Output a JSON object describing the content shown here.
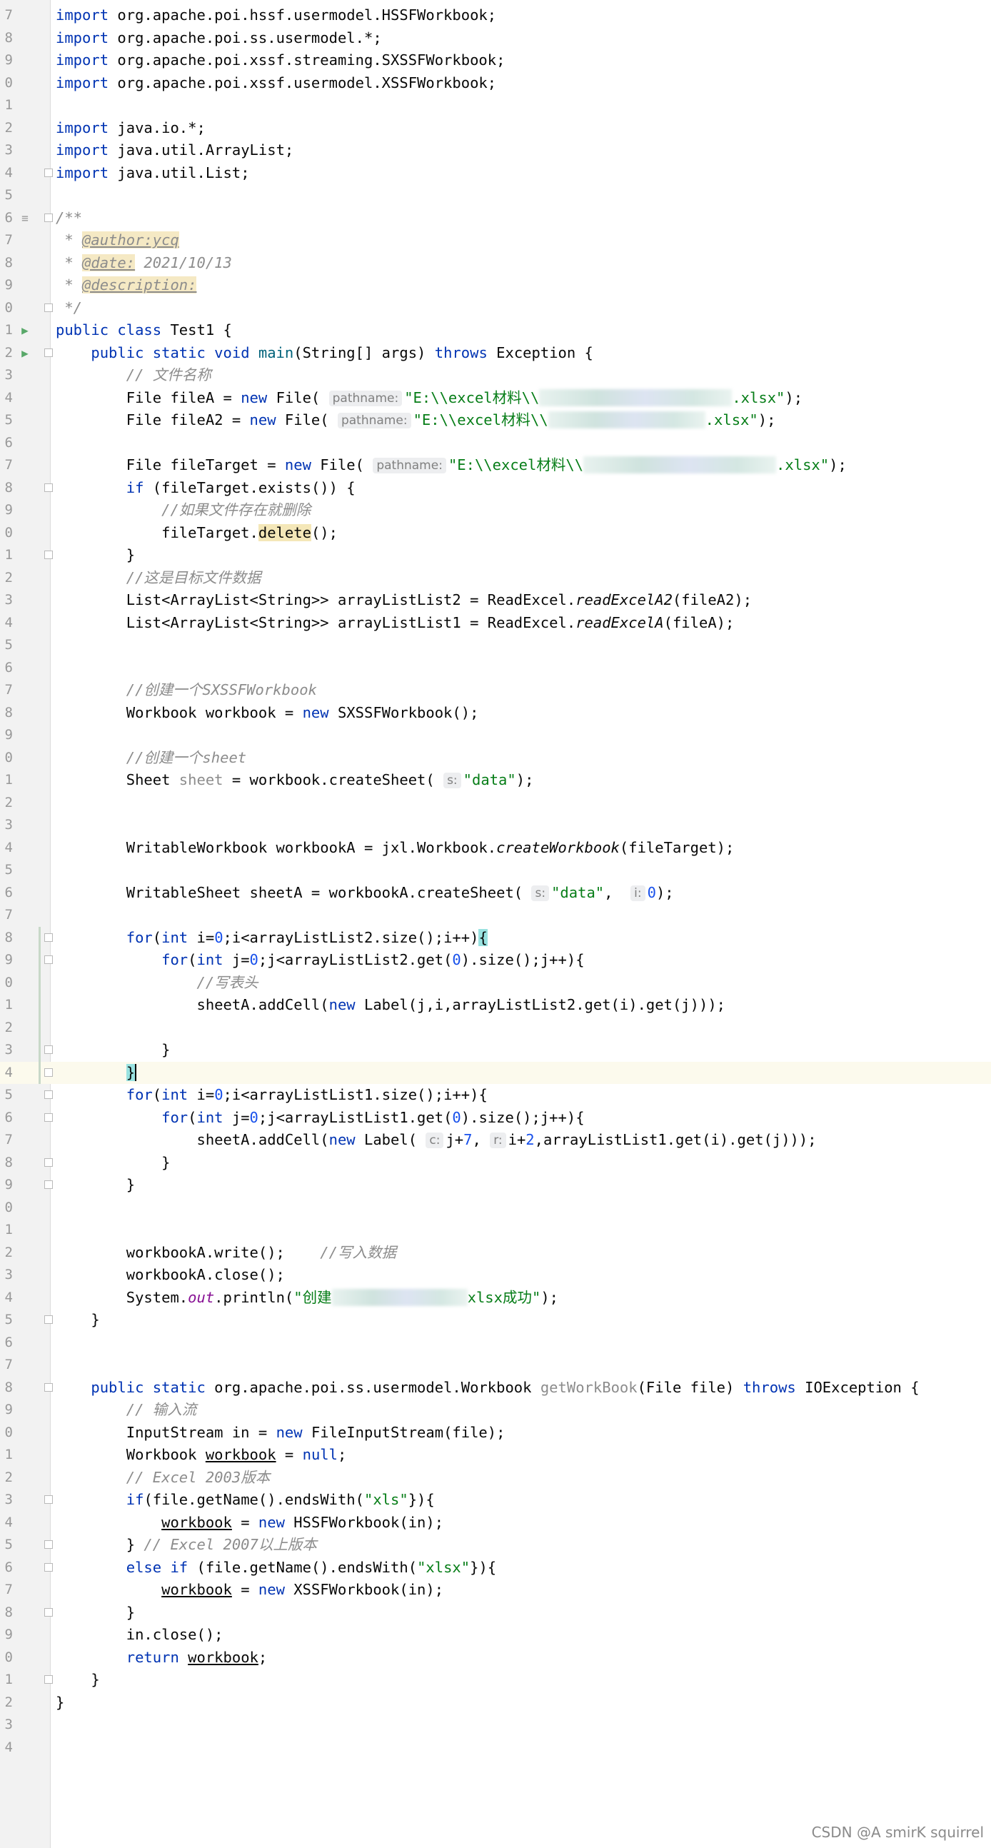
{
  "editor": {
    "watermark": "CSDN @A smirK squirrel",
    "lines": [
      {
        "n": "7",
        "segs": [
          [
            "kw",
            "import "
          ],
          [
            "",
            "org.apache.poi.hssf.usermodel.HSSFWorkbook;"
          ]
        ]
      },
      {
        "n": "8",
        "segs": [
          [
            "kw",
            "import "
          ],
          [
            "",
            "org.apache.poi.ss.usermodel.*;"
          ]
        ]
      },
      {
        "n": "9",
        "segs": [
          [
            "kw",
            "import "
          ],
          [
            "",
            "org.apache.poi.xssf.streaming.SXSSFWorkbook;"
          ]
        ]
      },
      {
        "n": "0",
        "segs": [
          [
            "kw",
            "import "
          ],
          [
            "",
            "org.apache.poi.xssf.usermodel.XSSFWorkbook;"
          ]
        ]
      },
      {
        "n": "1",
        "segs": []
      },
      {
        "n": "2",
        "segs": [
          [
            "kw",
            "import "
          ],
          [
            "",
            "java.io.*;"
          ]
        ]
      },
      {
        "n": "3",
        "segs": [
          [
            "kw",
            "import "
          ],
          [
            "",
            "java.util.ArrayList;"
          ]
        ]
      },
      {
        "n": "4",
        "fold": true,
        "segs": [
          [
            "kw",
            "import "
          ],
          [
            "",
            "java.util.List;"
          ]
        ]
      },
      {
        "n": "5",
        "segs": []
      },
      {
        "n": "6",
        "fold": true,
        "mark": "≡",
        "segs": [
          [
            "doc",
            "/**"
          ]
        ]
      },
      {
        "n": "7",
        "segs": [
          [
            "doc",
            " * "
          ],
          [
            "tag",
            "@author:ycq"
          ]
        ]
      },
      {
        "n": "8",
        "segs": [
          [
            "doc",
            " * "
          ],
          [
            "tag",
            "@date:"
          ],
          [
            "doc",
            " 2021/10/13"
          ]
        ]
      },
      {
        "n": "9",
        "segs": [
          [
            "doc",
            " * "
          ],
          [
            "tag",
            "@description:"
          ]
        ]
      },
      {
        "n": "0",
        "fold": true,
        "segs": [
          [
            "doc",
            " */"
          ]
        ]
      },
      {
        "n": "1",
        "mark": "▶",
        "segs": [
          [
            "kw",
            "public class "
          ],
          [
            "",
            "Test1 {"
          ]
        ]
      },
      {
        "n": "2",
        "mark": "▶",
        "fold": true,
        "segs": [
          [
            "",
            "    "
          ],
          [
            "kw",
            "public static void "
          ],
          [
            "mth",
            "main"
          ],
          [
            "",
            "(String[] args) "
          ],
          [
            "kw",
            "throws "
          ],
          [
            "",
            "Exception {"
          ]
        ]
      },
      {
        "n": "3",
        "segs": [
          [
            "",
            "        "
          ],
          [
            "cm",
            "// 文件名称"
          ]
        ]
      },
      {
        "n": "4",
        "segs": [
          [
            "",
            "        File fileA = "
          ],
          [
            "kw",
            "new "
          ],
          [
            "",
            "File( "
          ],
          [
            "hint",
            "pathname:"
          ],
          [
            "str",
            "\"E:\\\\excel材料\\\\"
          ],
          [
            "blur",
            "w270"
          ],
          [
            "str",
            ".xlsx\""
          ],
          [
            "",
            ");"
          ]
        ]
      },
      {
        "n": "5",
        "segs": [
          [
            "",
            "        File fileA2 = "
          ],
          [
            "kw",
            "new "
          ],
          [
            "",
            "File( "
          ],
          [
            "hint",
            "pathname:"
          ],
          [
            "str",
            "\"E:\\\\excel材料\\\\"
          ],
          [
            "blur",
            "w220"
          ],
          [
            "str",
            ".xlsx\""
          ],
          [
            "",
            ");"
          ]
        ]
      },
      {
        "n": "6",
        "segs": []
      },
      {
        "n": "7",
        "segs": [
          [
            "",
            "        File fileTarget = "
          ],
          [
            "kw",
            "new "
          ],
          [
            "",
            "File( "
          ],
          [
            "hint",
            "pathname:"
          ],
          [
            "str",
            "\"E:\\\\excel材料\\\\"
          ],
          [
            "blur",
            "w270"
          ],
          [
            "str",
            ".xlsx\""
          ],
          [
            "",
            ");"
          ]
        ]
      },
      {
        "n": "8",
        "fold": true,
        "segs": [
          [
            "",
            "        "
          ],
          [
            "kw",
            "if "
          ],
          [
            "",
            "(fileTarget.exists()) {"
          ]
        ]
      },
      {
        "n": "9",
        "segs": [
          [
            "",
            "            "
          ],
          [
            "cm",
            "//如果文件存在就删除"
          ]
        ]
      },
      {
        "n": "0",
        "segs": [
          [
            "",
            "            fileTarget."
          ],
          [
            "hl",
            "delete"
          ],
          [
            "",
            "();"
          ]
        ]
      },
      {
        "n": "1",
        "fold": true,
        "segs": [
          [
            "",
            "        }"
          ]
        ]
      },
      {
        "n": "2",
        "segs": [
          [
            "",
            "        "
          ],
          [
            "cm",
            "//这是目标文件数据"
          ]
        ]
      },
      {
        "n": "3",
        "segs": [
          [
            "",
            "        List<ArrayList<String>> arrayListList2 = ReadExcel."
          ],
          [
            "smth",
            "readExcelA2"
          ],
          [
            "",
            "(fileA2);"
          ]
        ]
      },
      {
        "n": "4",
        "segs": [
          [
            "",
            "        List<ArrayList<String>> arrayListList1 = ReadExcel."
          ],
          [
            "smth",
            "readExcelA"
          ],
          [
            "",
            "(fileA);"
          ]
        ]
      },
      {
        "n": "5",
        "segs": []
      },
      {
        "n": "6",
        "segs": []
      },
      {
        "n": "7",
        "segs": [
          [
            "",
            "        "
          ],
          [
            "cm",
            "//创建一个SXSSFWorkbook"
          ]
        ]
      },
      {
        "n": "8",
        "segs": [
          [
            "",
            "        Workbook workbook = "
          ],
          [
            "kw",
            "new "
          ],
          [
            "",
            "SXSSFWorkbook();"
          ]
        ]
      },
      {
        "n": "9",
        "segs": []
      },
      {
        "n": "0",
        "segs": [
          [
            "",
            "        "
          ],
          [
            "cm",
            "//创建一个sheet"
          ]
        ]
      },
      {
        "n": "1",
        "segs": [
          [
            "",
            "        Sheet "
          ],
          [
            "unused",
            "sheet"
          ],
          [
            "",
            " = workbook.createSheet( "
          ],
          [
            "hint",
            "s:"
          ],
          [
            "str",
            "\"data\""
          ],
          [
            "",
            ");"
          ]
        ]
      },
      {
        "n": "2",
        "segs": []
      },
      {
        "n": "3",
        "segs": []
      },
      {
        "n": "4",
        "segs": [
          [
            "",
            "        WritableWorkbook workbookA = jxl.Workbook."
          ],
          [
            "smth",
            "createWorkbook"
          ],
          [
            "",
            "(fileTarget);"
          ]
        ]
      },
      {
        "n": "5",
        "segs": []
      },
      {
        "n": "6",
        "segs": [
          [
            "",
            "        WritableSheet sheetA = workbookA.createSheet( "
          ],
          [
            "hint",
            "s:"
          ],
          [
            "str",
            "\"data\""
          ],
          [
            "",
            ",  "
          ],
          [
            "hint",
            "i:"
          ],
          [
            "num",
            "0"
          ],
          [
            "",
            ");"
          ]
        ]
      },
      {
        "n": "7",
        "segs": []
      },
      {
        "n": "8",
        "fold": true,
        "segs": [
          [
            "",
            "        "
          ],
          [
            "kw",
            "for"
          ],
          [
            "",
            "("
          ],
          [
            "kw",
            "int "
          ],
          [
            "",
            "i="
          ],
          [
            "num",
            "0"
          ],
          [
            "",
            ";i<arrayListList2.size();i++)"
          ],
          [
            "bracematch",
            "{"
          ]
        ]
      },
      {
        "n": "9",
        "fold": true,
        "segs": [
          [
            "",
            "            "
          ],
          [
            "kw",
            "for"
          ],
          [
            "",
            "("
          ],
          [
            "kw",
            "int "
          ],
          [
            "",
            "j="
          ],
          [
            "num",
            "0"
          ],
          [
            "",
            ";j<arrayListList2.get("
          ],
          [
            "num",
            "0"
          ],
          [
            "",
            ").size();j++){"
          ]
        ]
      },
      {
        "n": "0",
        "segs": [
          [
            "",
            "                "
          ],
          [
            "cm",
            "//写表头"
          ]
        ]
      },
      {
        "n": "1",
        "segs": [
          [
            "",
            "                sheetA.addCell("
          ],
          [
            "kw",
            "new "
          ],
          [
            "",
            "Label(j,i,arrayListList2.get(i).get(j)));"
          ]
        ]
      },
      {
        "n": "2",
        "segs": []
      },
      {
        "n": "3",
        "fold": true,
        "segs": [
          [
            "",
            "            }"
          ]
        ]
      },
      {
        "n": "4",
        "fold": true,
        "current": true,
        "segs": [
          [
            "",
            "        "
          ],
          [
            "bracematch",
            "}"
          ],
          [
            "caret",
            ""
          ]
        ]
      },
      {
        "n": "5",
        "fold": true,
        "segs": [
          [
            "",
            "        "
          ],
          [
            "kw",
            "for"
          ],
          [
            "",
            "("
          ],
          [
            "kw",
            "int "
          ],
          [
            "",
            "i="
          ],
          [
            "num",
            "0"
          ],
          [
            "",
            ";i<arrayListList1.size();i++){"
          ]
        ]
      },
      {
        "n": "6",
        "fold": true,
        "segs": [
          [
            "",
            "            "
          ],
          [
            "kw",
            "for"
          ],
          [
            "",
            "("
          ],
          [
            "kw",
            "int "
          ],
          [
            "",
            "j="
          ],
          [
            "num",
            "0"
          ],
          [
            "",
            ";j<arrayListList1.get("
          ],
          [
            "num",
            "0"
          ],
          [
            "",
            ").size();j++){"
          ]
        ]
      },
      {
        "n": "7",
        "segs": [
          [
            "",
            "                sheetA.addCell("
          ],
          [
            "kw",
            "new "
          ],
          [
            "",
            "Label( "
          ],
          [
            "hint",
            "c:"
          ],
          [
            "",
            "j+"
          ],
          [
            "num",
            "7"
          ],
          [
            "",
            ", "
          ],
          [
            "hint",
            "r:"
          ],
          [
            "",
            "i+"
          ],
          [
            "num",
            "2"
          ],
          [
            "",
            ",arrayListList1.get(i).get(j)));"
          ]
        ]
      },
      {
        "n": "8",
        "fold": true,
        "segs": [
          [
            "",
            "            }"
          ]
        ]
      },
      {
        "n": "9",
        "fold": true,
        "segs": [
          [
            "",
            "        }"
          ]
        ]
      },
      {
        "n": "0",
        "segs": []
      },
      {
        "n": "1",
        "segs": []
      },
      {
        "n": "2",
        "segs": [
          [
            "",
            "        workbookA.write();    "
          ],
          [
            "cm",
            "//写入数据"
          ]
        ]
      },
      {
        "n": "3",
        "segs": [
          [
            "",
            "        workbookA.close();"
          ]
        ]
      },
      {
        "n": "4",
        "segs": [
          [
            "",
            "        System."
          ],
          [
            "sfld",
            "out"
          ],
          [
            "",
            ".println("
          ],
          [
            "str",
            "\"创建"
          ],
          [
            "blur",
            "w190"
          ],
          [
            "str",
            "xlsx成功\""
          ],
          [
            "",
            ");"
          ]
        ]
      },
      {
        "n": "5",
        "fold": true,
        "segs": [
          [
            "",
            "    }"
          ]
        ]
      },
      {
        "n": "6",
        "segs": []
      },
      {
        "n": "7",
        "segs": []
      },
      {
        "n": "8",
        "fold": true,
        "segs": [
          [
            "",
            "    "
          ],
          [
            "kw",
            "public static "
          ],
          [
            "",
            "org.apache.poi.ss.usermodel.Workbook "
          ],
          [
            "unused",
            "getWorkBook"
          ],
          [
            "",
            "(File file) "
          ],
          [
            "kw",
            "throws "
          ],
          [
            "",
            "IOException {"
          ]
        ]
      },
      {
        "n": "9",
        "segs": [
          [
            "",
            "        "
          ],
          [
            "cm",
            "// 输入流"
          ]
        ]
      },
      {
        "n": "0",
        "segs": [
          [
            "",
            "        InputStream in = "
          ],
          [
            "kw",
            "new "
          ],
          [
            "",
            "FileInputStream(file);"
          ]
        ]
      },
      {
        "n": "1",
        "segs": [
          [
            "",
            "        Workbook "
          ],
          [
            "reassigned",
            "workbook"
          ],
          [
            "",
            " = "
          ],
          [
            "kw",
            "null"
          ],
          [
            "",
            ";"
          ]
        ]
      },
      {
        "n": "2",
        "segs": [
          [
            "",
            "        "
          ],
          [
            "cm",
            "// Excel 2003版本"
          ]
        ]
      },
      {
        "n": "3",
        "fold": true,
        "segs": [
          [
            "",
            "        "
          ],
          [
            "kw",
            "if"
          ],
          [
            "",
            "(file.getName().endsWith("
          ],
          [
            "str",
            "\"xls\""
          ],
          [
            "",
            "}){"
          ]
        ]
      },
      {
        "n": "4",
        "segs": [
          [
            "",
            "            "
          ],
          [
            "reassigned",
            "workbook"
          ],
          [
            "",
            " = "
          ],
          [
            "kw",
            "new "
          ],
          [
            "",
            "HSSFWorkbook(in);"
          ]
        ]
      },
      {
        "n": "5",
        "fold": true,
        "segs": [
          [
            "",
            "        } "
          ],
          [
            "cm",
            "// Excel 2007以上版本"
          ]
        ]
      },
      {
        "n": "6",
        "fold": true,
        "segs": [
          [
            "",
            "        "
          ],
          [
            "kw",
            "else if "
          ],
          [
            "",
            "(file.getName().endsWith("
          ],
          [
            "str",
            "\"xlsx\""
          ],
          [
            "",
            "}){"
          ]
        ]
      },
      {
        "n": "7",
        "segs": [
          [
            "",
            "            "
          ],
          [
            "reassigned",
            "workbook"
          ],
          [
            "",
            " = "
          ],
          [
            "kw",
            "new "
          ],
          [
            "",
            "XSSFWorkbook(in);"
          ]
        ]
      },
      {
        "n": "8",
        "fold": true,
        "segs": [
          [
            "",
            "        }"
          ]
        ]
      },
      {
        "n": "9",
        "segs": [
          [
            "",
            "        in.close();"
          ]
        ]
      },
      {
        "n": "0",
        "segs": [
          [
            "",
            "        "
          ],
          [
            "kw",
            "return "
          ],
          [
            "reassigned",
            "workbook"
          ],
          [
            "",
            ";"
          ]
        ]
      },
      {
        "n": "1",
        "fold": true,
        "segs": [
          [
            "",
            "    }"
          ]
        ]
      },
      {
        "n": "2",
        "segs": [
          [
            "",
            "}"
          ]
        ]
      },
      {
        "n": "3",
        "segs": []
      },
      {
        "n": "4",
        "segs": []
      }
    ]
  }
}
